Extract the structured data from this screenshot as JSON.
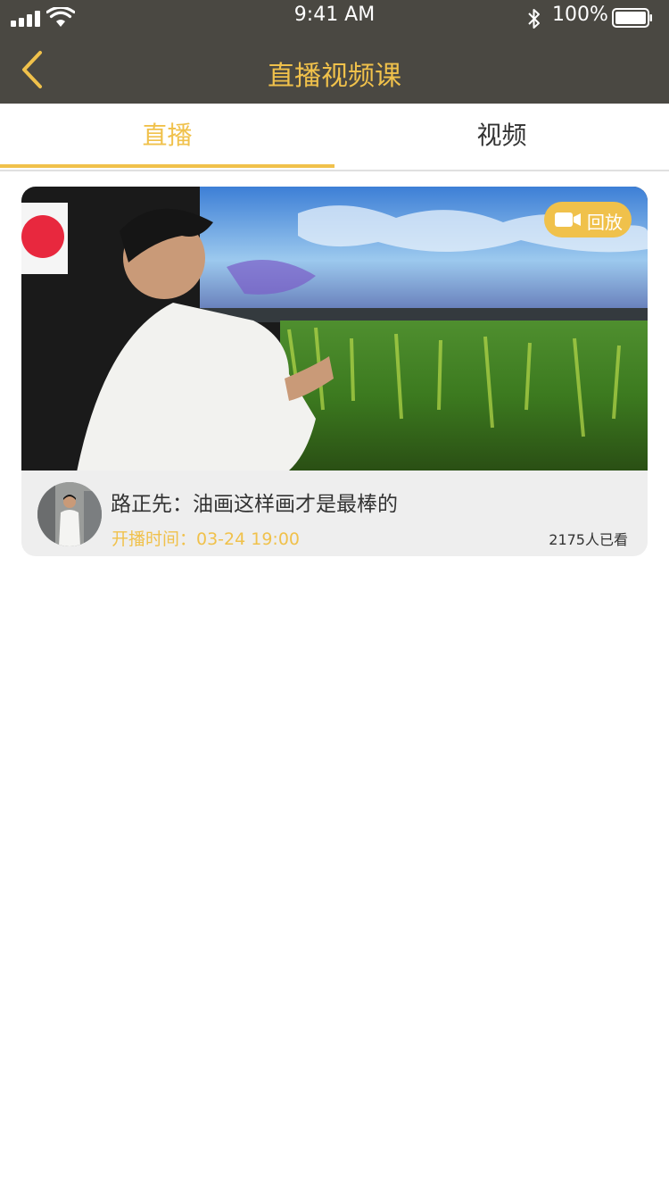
{
  "status_bar": {
    "time": "9:41 AM",
    "battery": "100%"
  },
  "nav": {
    "back_icon": "chevron-left-icon",
    "title": "直播视频课"
  },
  "tabs": [
    {
      "label": "直播",
      "active": true
    },
    {
      "label": "视频",
      "active": false
    }
  ],
  "live_list": [
    {
      "badge": "回放",
      "badge_icon": "video-camera-icon",
      "title": "路正先：油画这样画才是最棒的",
      "start_time": "开播时间：03-24  19:00",
      "views": "2175人已看"
    }
  ],
  "colors": {
    "accent": "#f0c14b",
    "header_bg": "#4a4842",
    "card_bg": "#eeeeee",
    "text_dark": "#333333"
  }
}
